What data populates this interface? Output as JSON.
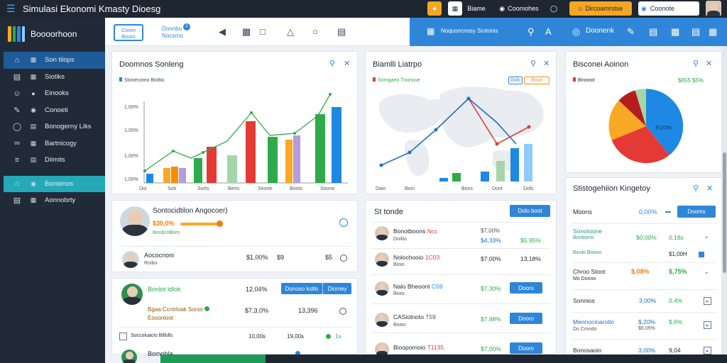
{
  "topbar": {
    "title": "Simulasi Ekonomi Kmasty Dioesg",
    "btn1": "Biame",
    "btn2": "Coomohes",
    "btn3": "Dircoamrstse",
    "search_value": "Coonote"
  },
  "sidebar": {
    "brand": "Boooorhoon",
    "items": [
      {
        "label": "Son tilops",
        "icon": "home-icon"
      },
      {
        "label": "Siotiks",
        "icon": "grid-icon"
      },
      {
        "label": "Einooks",
        "icon": "people-icon"
      },
      {
        "label": "Conoeti",
        "icon": "edit-icon"
      },
      {
        "label": "Bonogerny Liks",
        "icon": "globe-icon"
      },
      {
        "label": "Bartnicogy",
        "icon": "link-icon"
      },
      {
        "label": "Diimits",
        "icon": "chart-icon"
      },
      {
        "label": "Bontenos",
        "icon": "settings-icon"
      },
      {
        "label": "Aonnobrty",
        "icon": "document-icon"
      }
    ]
  },
  "subbar": {
    "pill": "Comn Bours",
    "link": "Donnbo Nocsrno",
    "badge": "0",
    "blue_label": "Noquoncnosy Srotonis",
    "right_label": "Doonenk"
  },
  "card_top_left": {
    "title": "Doomnos Sonleng",
    "legend": "Stonecomo Bioltio",
    "y_ticks": [
      "1,00%",
      "1,00%",
      "1,00%",
      "1,00%"
    ],
    "x_ticks": [
      "Doi",
      "Soti",
      "Sorts",
      "Berts",
      "Seone",
      "Boots",
      "Soone"
    ],
    "colors": {
      "red": "#e53935",
      "yellow": "#f9a825",
      "orange": "#fb8c00",
      "green": "#2eaa4a",
      "lightgreen": "#a5d6a7",
      "purple": "#b39ddb",
      "blue": "#1e88e5",
      "lightblue": "#90caf9",
      "line": "#2eaa4a"
    }
  },
  "card_map": {
    "title": "Biamlli Liatrpo",
    "legend": "Sorngaeo Tnonoue",
    "btn1": "Dolo",
    "btn2": "Boun",
    "x_ticks": [
      "Dain",
      "Boni",
      "Bons",
      "Dont",
      "Dofs"
    ]
  },
  "card_pie": {
    "title": "Bisconei Aoinon",
    "legend": "Binooot",
    "value": "$655 $5%",
    "center": "EOON"
  },
  "card_profile": {
    "name": "Sontocidtilon Angocoer)",
    "value": "$30,0%",
    "sub": "Bonbcolllom",
    "row_name": "Aococnoni",
    "row_sub": "Roibo",
    "row_value": "$1,00%",
    "row_icon": "$9",
    "row_end": "$5"
  },
  "card_green": {
    "title": "Bonlot ldlok",
    "value": "12,04%",
    "btn1": "Donoso kotlo",
    "btn2": "Diomey",
    "line1": "Bgaa Ccntrloak Sorso",
    "line2": "Eooonloot",
    "value2": "$7,3,0%",
    "value3": "13,396",
    "row3_a": "Soccoluaclo Billslls",
    "row3_b": "10,00s",
    "row3_c": "19,00s",
    "row3_d": "1s",
    "bottom": "Bomobla"
  },
  "card_stocks": {
    "title": "St tonde",
    "btn": "Dolo boot",
    "rows": [
      {
        "name": "Bonotboons",
        "tag": "Ncc",
        "sub": "Doiliio",
        "v1": "$7,00%",
        "v2": "$4,33%",
        "v3": "$5,95%"
      },
      {
        "name": "Nolochooio",
        "tag": "1C03",
        "sub": "Bioio",
        "v1": "$7,00%",
        "v2": "13,18%",
        "btn": ""
      },
      {
        "name": "Nalo Bheoont",
        "tag": "C59",
        "sub": "Bioio",
        "v1": "$7,30%",
        "btn": "Dooro"
      },
      {
        "name": "CASiotnoto",
        "tag": "T59",
        "sub": "Boion",
        "v1": "$7,98%",
        "btn": "Dooro"
      },
      {
        "name": "Bioopornoio",
        "tag": "T1135",
        "sub": "",
        "v1": "$7,00%",
        "btn": "Dooro"
      }
    ]
  },
  "card_history": {
    "title": "Stistogehiion Kingetoy",
    "rows": [
      {
        "name": "Moons",
        "value": "0,00%",
        "right": "",
        "btn": "Dooms"
      },
      {
        "name": "Sonotoone",
        "sub": "Bonkomo",
        "value": "$0,00%",
        "right": "0,18s",
        "sub2": "Boulo Boooo",
        "tail": "$1,00H"
      },
      {
        "name": "Chroo Stoot",
        "sub": "Mo Donno",
        "value": "$,08%",
        "right": "$,75%"
      },
      {
        "name": "Sonnios",
        "value": "3,00%",
        "right": "0,4%"
      },
      {
        "name": "Mennocinarotin",
        "sub": "Do Cmodo",
        "value": "$,20%",
        "right": "$,6%",
        "sub2": "$5,05%"
      },
      {
        "name": "Bonosaoin",
        "value": "3,00%",
        "right": "9,04"
      }
    ]
  }
}
